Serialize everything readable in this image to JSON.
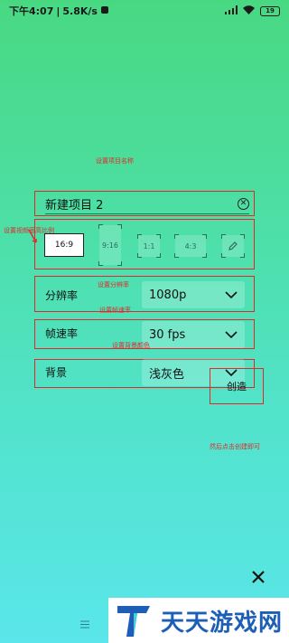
{
  "status_bar": {
    "time": "下午4:07",
    "speed": "5.8K/s",
    "battery": "19"
  },
  "project": {
    "name": "新建项目 2"
  },
  "ratios": [
    {
      "label": "16:9",
      "selected": true
    },
    {
      "label": "9:16",
      "selected": false
    },
    {
      "label": "1:1",
      "selected": false
    },
    {
      "label": "4:3",
      "selected": false
    },
    {
      "label": "",
      "selected": false
    }
  ],
  "settings": {
    "resolution": {
      "label": "分辨率",
      "value": "1080p"
    },
    "framerate": {
      "label": "帧速率",
      "value": "30 fps"
    },
    "background": {
      "label": "背景",
      "value": "浅灰色"
    }
  },
  "create_label": "创造",
  "annotations": {
    "name": "设置项目名称",
    "ratio": "设置视频宽高比例",
    "resolution": "设置分辨率",
    "framerate": "设置帧速率",
    "background": "设置背景颜色",
    "create": "然后点击创建即可"
  },
  "watermark": {
    "text": "天天游戏网"
  },
  "colors": {
    "annotation": "#e02a2a",
    "watermark_text": "#1d5fb6"
  },
  "icons": [
    "signal-icon",
    "wifi-icon",
    "battery-icon",
    "clear-icon",
    "pencil-icon",
    "chevron-down-icon",
    "close-icon",
    "menu-icon"
  ]
}
